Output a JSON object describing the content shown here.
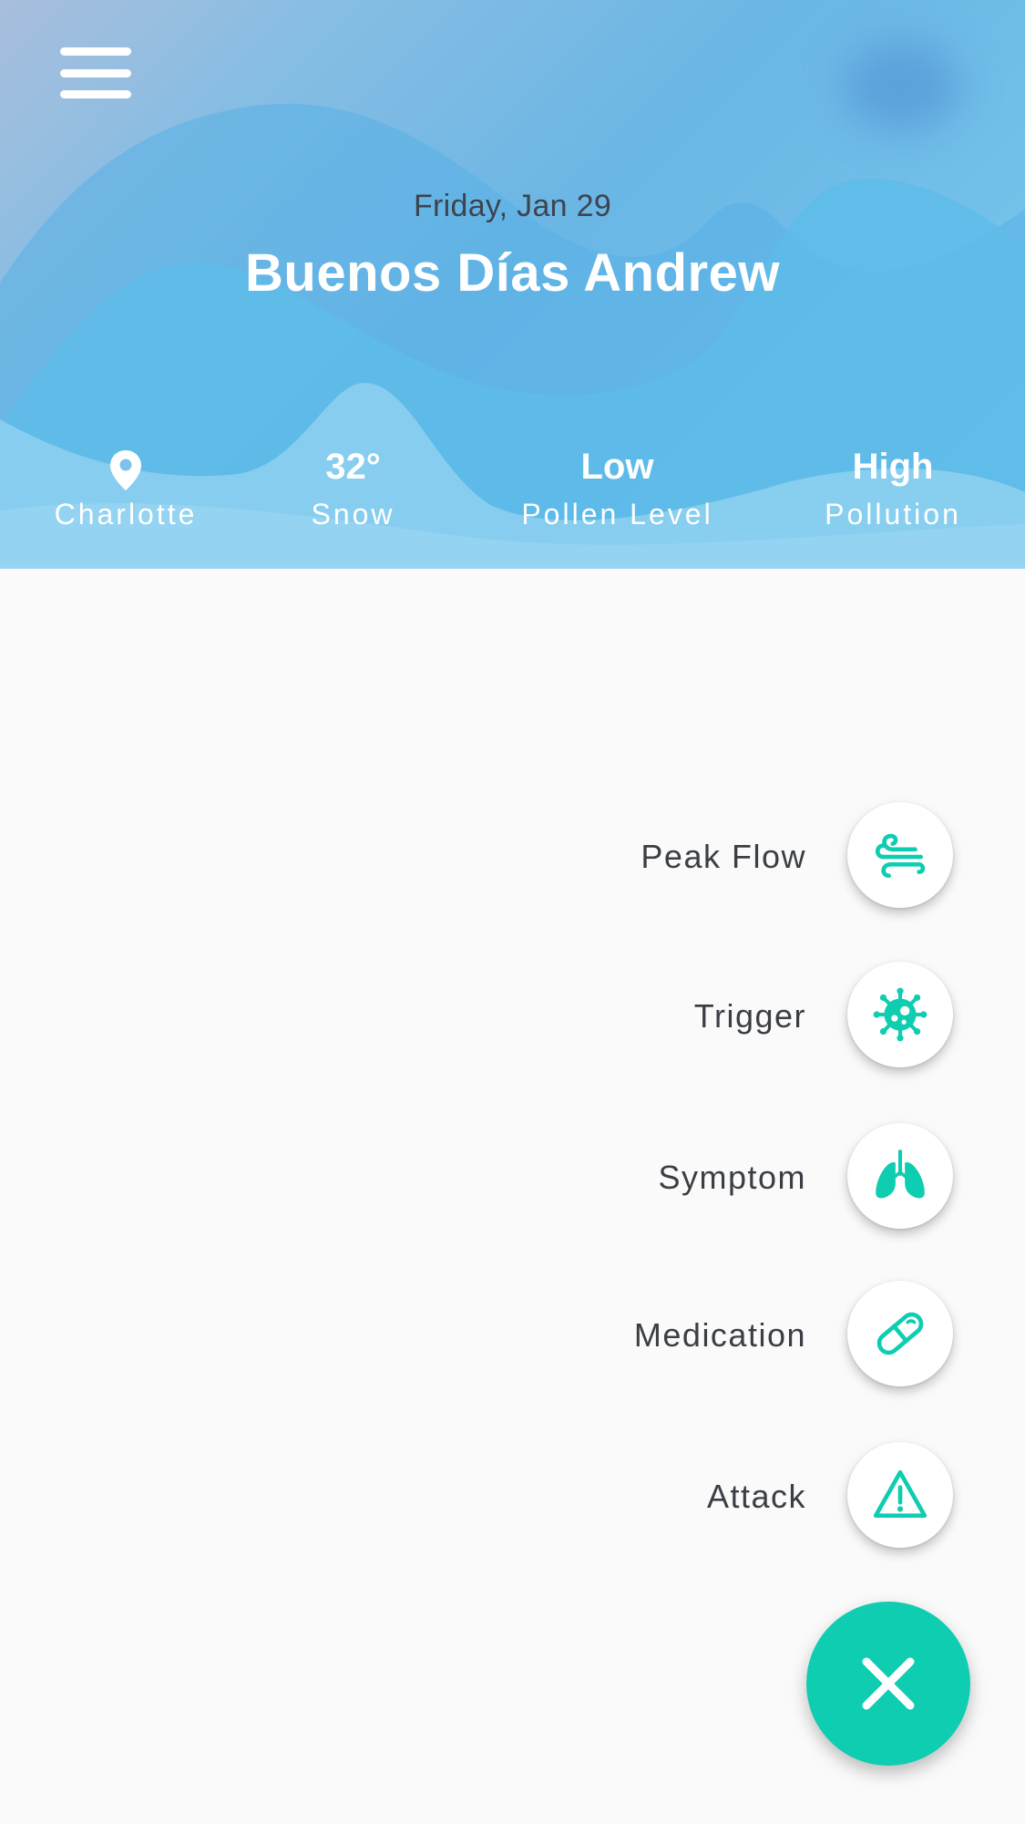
{
  "header": {
    "date": "Friday, Jan 29",
    "greeting": "Buenos Días Andrew",
    "stats": {
      "location": {
        "icon": "location-pin-icon",
        "label": "Charlotte"
      },
      "temperature": {
        "value": "32°",
        "label": "Snow"
      },
      "pollen": {
        "value": "Low",
        "label": "Pollen Level"
      },
      "pollution": {
        "value": "High",
        "label": "Pollution"
      }
    }
  },
  "menu": {
    "icon": "hamburger-menu-icon"
  },
  "actions": [
    {
      "label": "Peak Flow",
      "icon": "wind-icon"
    },
    {
      "label": "Trigger",
      "icon": "virus-icon"
    },
    {
      "label": "Symptom",
      "icon": "lungs-icon"
    },
    {
      "label": "Medication",
      "icon": "pill-icon"
    },
    {
      "label": "Attack",
      "icon": "warning-icon"
    }
  ],
  "close_button": {
    "icon": "close-icon"
  },
  "colors": {
    "accent": "#0fcdb0",
    "header_gradient_start": "#a9bedd",
    "header_gradient_end": "#8ccdee",
    "text_dark": "#3b3f45",
    "background": "#fafafa"
  }
}
